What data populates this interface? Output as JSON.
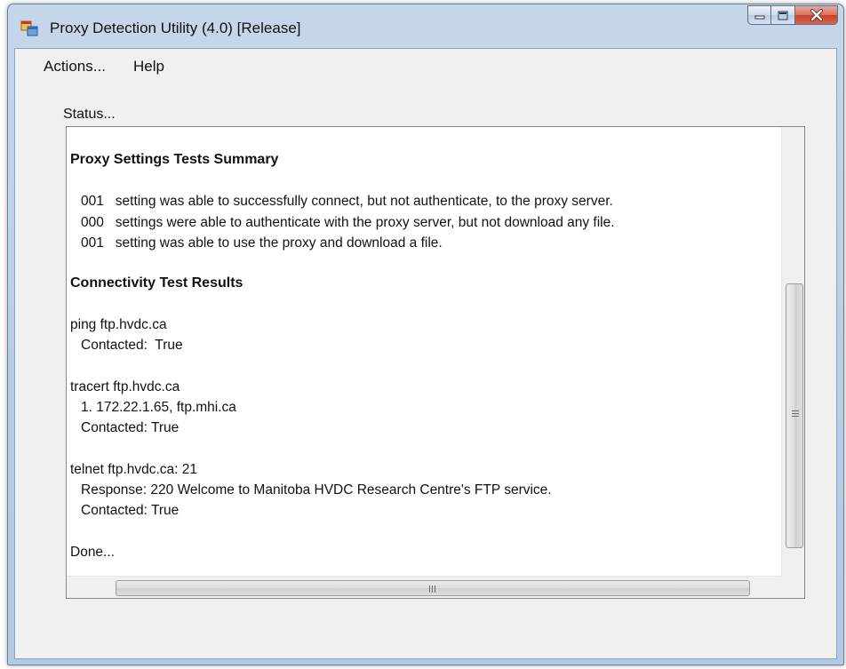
{
  "window": {
    "title": "Proxy Detection Utility (4.0) [Release]"
  },
  "menu": {
    "items": [
      "Actions...",
      "Help"
    ]
  },
  "status_label": "Status...",
  "output": {
    "summary_heading": "Proxy Settings Tests Summary",
    "summary_lines": [
      "001   setting was able to successfully connect, but not authenticate, to the proxy server.",
      "000   settings were able to authenticate with the proxy server, but not download any file.",
      "001   setting was able to use the proxy and download a file."
    ],
    "connectivity_heading": "Connectivity Test Results",
    "ping": {
      "command": "ping ftp.hvdc.ca",
      "result": "Contacted:  True"
    },
    "tracert": {
      "command": "tracert ftp.hvdc.ca",
      "hop": "1. 172.22.1.65, ftp.mhi.ca",
      "result": "Contacted: True"
    },
    "telnet": {
      "command": "telnet ftp.hvdc.ca: 21",
      "response": "Response: 220 Welcome to Manitoba HVDC Research Centre's FTP service.",
      "result": "Contacted: True"
    },
    "done": "Done..."
  },
  "scrollbars": {
    "vertical_position": "middle",
    "horizontal_position": "left"
  },
  "icons": {
    "app": "app-window-icon",
    "minimize": "minimize-icon",
    "maximize": "maximize-icon",
    "close": "close-icon"
  },
  "colors": {
    "titlebar": "#b9cee6",
    "close_button": "#c8412a",
    "client_background": "#f0f0f0"
  }
}
